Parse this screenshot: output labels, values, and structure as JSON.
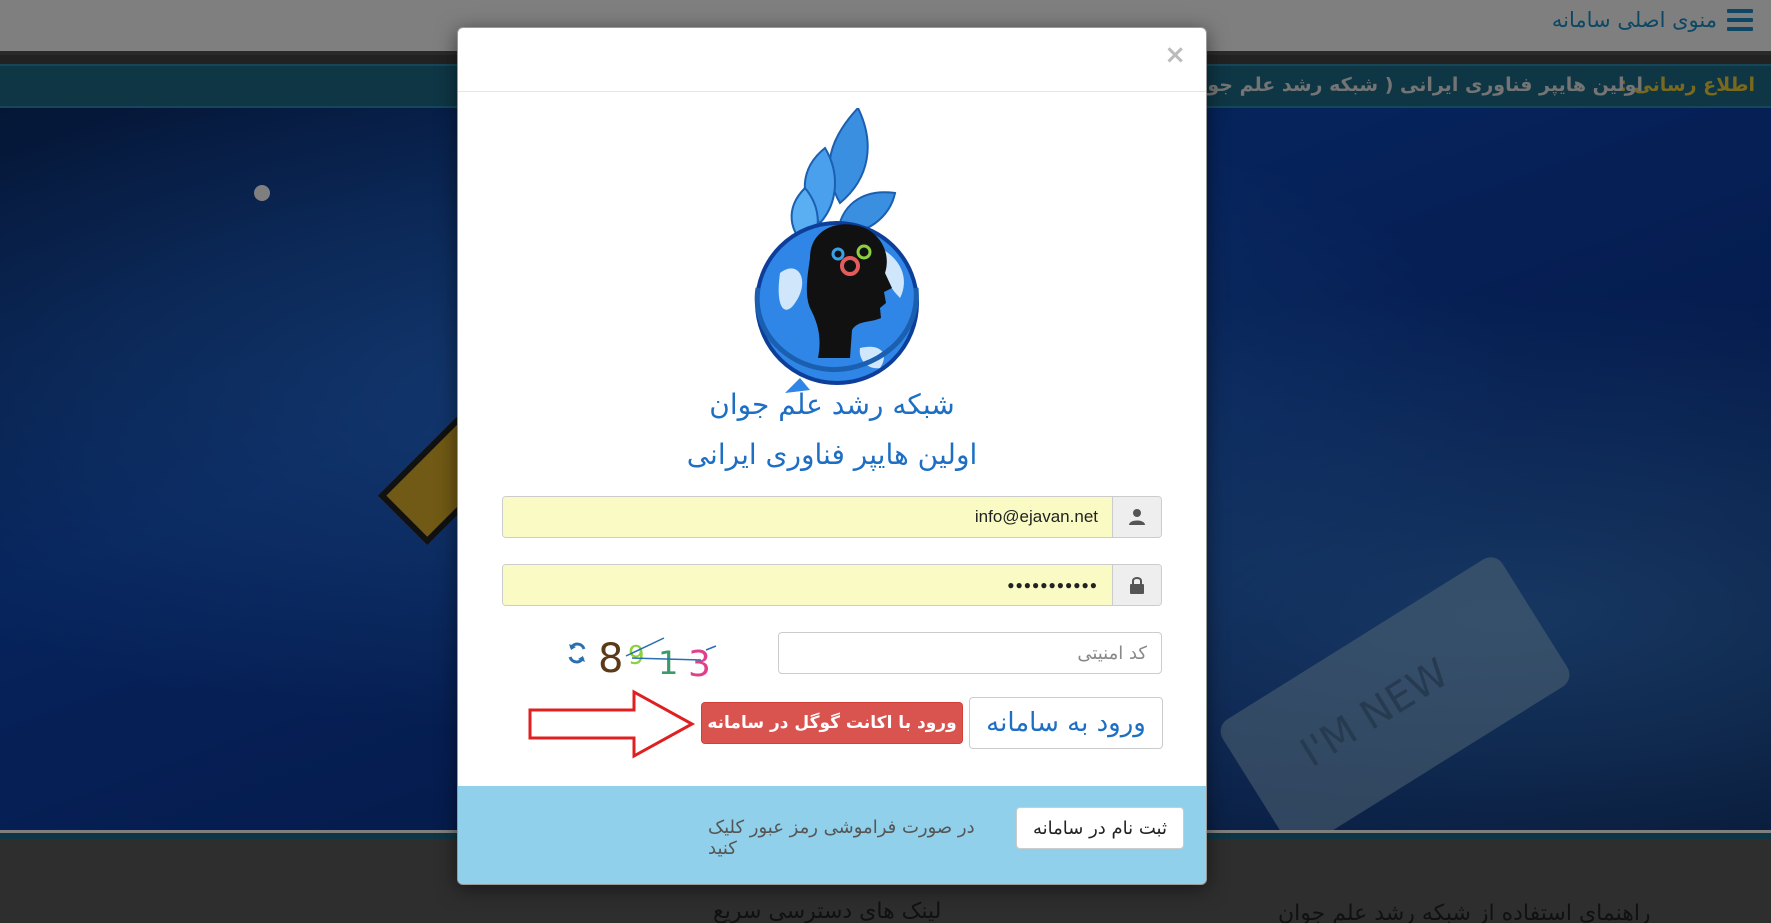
{
  "header": {
    "menu_label": "منوی اصلی سامانه"
  },
  "newsbar": {
    "label": "اطلاع رسانی :",
    "text": "اولین هایپر فناوری ایرانی ( شبکه رشد علم جوان ) راه ان"
  },
  "hero": {
    "sign_text": "I'M NEW"
  },
  "footer": {
    "quick_links": "لینک های دسترسی سریع",
    "guide": "راهنمای استفاده از شبکه رشد علم جوان"
  },
  "modal": {
    "close_label": "×",
    "title_line1": "شبکه رشد علم جوان",
    "title_line2": "اولین هایپر فناوری ایرانی",
    "email_value": "info@ejavan.net",
    "password_value": "●●●●●●●●●●●",
    "captcha_placeholder": "کد امنیتی",
    "captcha_digits": [
      "8",
      "9",
      "1",
      "3"
    ],
    "google_button": "ورود با اکانت گوگل در سامانه",
    "login_button": "ورود به سامانه",
    "register_button": "ثبت نام در سامانه",
    "forgot_link": "در صورت فراموشی رمز عبور کلیک کنید"
  },
  "icons": {
    "menu": "hamburger-icon",
    "user": "user-icon",
    "lock": "lock-icon",
    "refresh": "refresh-icon",
    "arrow": "annotation-arrow"
  },
  "colors": {
    "brand_blue": "#1e6fc4",
    "accent_red": "#d9534f",
    "input_fill": "#fafbc4",
    "footer_blue": "#90d0ea",
    "news_label": "#f2d23c"
  }
}
